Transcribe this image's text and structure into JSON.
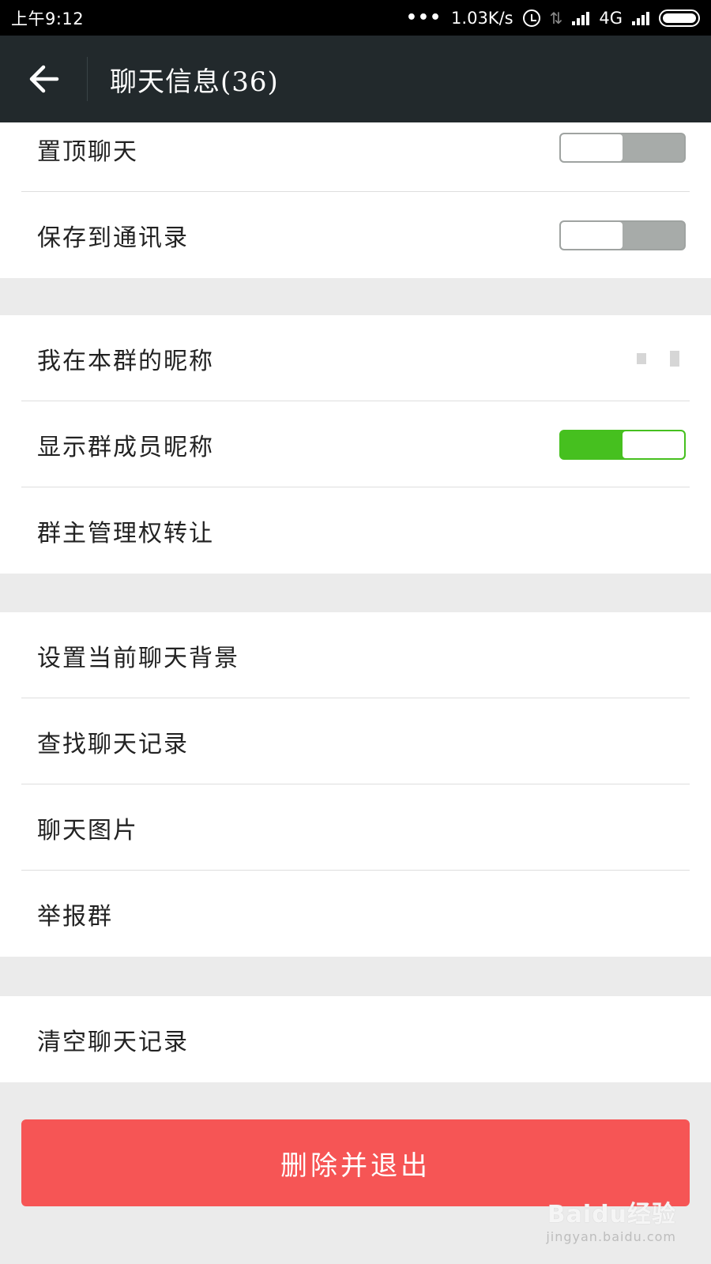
{
  "status_bar": {
    "time": "上午9:12",
    "network_speed": "1.03K/s",
    "network_type": "4G",
    "icons": [
      "dots-icon",
      "alarm-icon",
      "no-signal-icon",
      "signal-icon",
      "signal-icon",
      "battery-icon"
    ]
  },
  "header": {
    "title": "聊天信息(36)",
    "back_icon": "arrow-left-icon"
  },
  "groups": {
    "toggles": [
      {
        "label": "置顶聊天",
        "toggle_state": "off"
      },
      {
        "label": "保存到通讯录",
        "toggle_state": "off"
      }
    ],
    "group_settings": [
      {
        "label": "我在本群的昵称"
      },
      {
        "label": "显示群成员昵称",
        "toggle_state": "on"
      },
      {
        "label": "群主管理权转让"
      }
    ],
    "chat_settings": [
      {
        "label": "设置当前聊天背景"
      },
      {
        "label": "查找聊天记录"
      },
      {
        "label": "聊天图片"
      },
      {
        "label": "举报群"
      }
    ],
    "clear": [
      {
        "label": "清空聊天记录"
      }
    ]
  },
  "delete_button": {
    "label": "删除并退出"
  },
  "watermark": {
    "main": "Baidu经验",
    "sub": "jingyan.baidu.com"
  },
  "colors": {
    "status_bar": "#000000",
    "title_bar": "#22292c",
    "background": "#ebebeb",
    "toggle_on": "#46c01f",
    "toggle_off": "#a7aba9",
    "delete_button": "#f65555"
  }
}
